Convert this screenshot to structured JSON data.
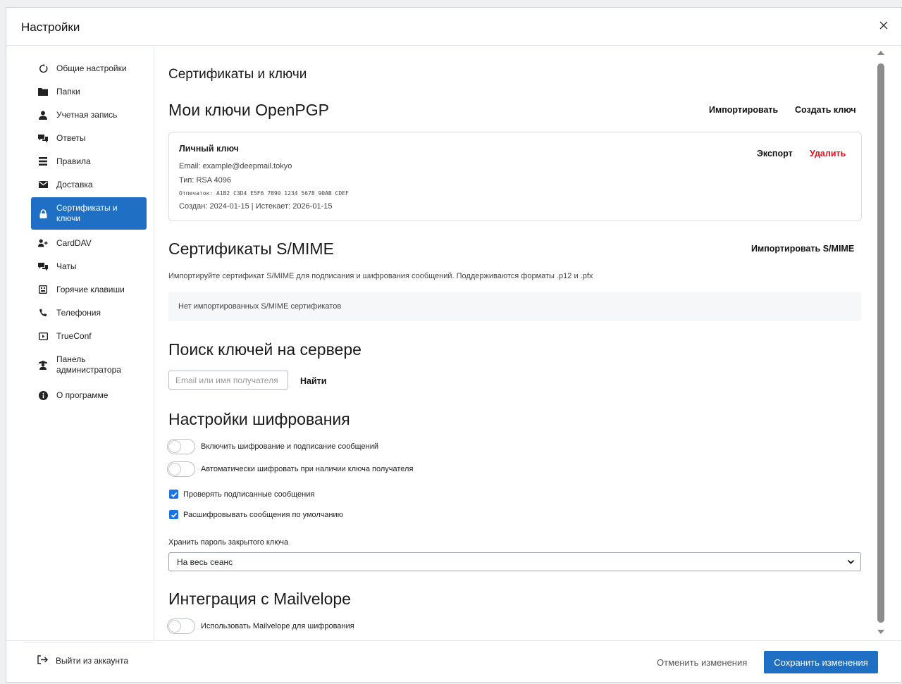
{
  "dialog": {
    "title": "Настройки"
  },
  "sidebar": {
    "items": [
      {
        "label": "Общие настройки",
        "icon": "refresh-icon"
      },
      {
        "label": "Папки",
        "icon": "folder-icon"
      },
      {
        "label": "Учетная запись",
        "icon": "user-icon"
      },
      {
        "label": "Ответы",
        "icon": "chat-icon"
      },
      {
        "label": "Правила",
        "icon": "list-icon"
      },
      {
        "label": "Доставка",
        "icon": "envelope-icon"
      },
      {
        "label": "Сертификаты и ключи",
        "icon": "lock-icon",
        "active": true
      },
      {
        "label": "CardDAV",
        "icon": "user-plus-icon"
      },
      {
        "label": "Чаты",
        "icon": "chat-icon"
      },
      {
        "label": "Горячие клавиши",
        "icon": "keyboard-icon"
      },
      {
        "label": "Телефония",
        "icon": "phone-icon"
      },
      {
        "label": "TrueConf",
        "icon": "video-icon"
      },
      {
        "label": "Панель администратора",
        "icon": "shield-user-icon"
      },
      {
        "label": "О программе",
        "icon": "info-icon"
      }
    ],
    "logout": "Выйти из аккаунта"
  },
  "content": {
    "page_title": "Сертификаты и ключи",
    "openpgp": {
      "title": "Мои ключи OpenPGP",
      "import": "Импортировать",
      "create": "Создать ключ",
      "key": {
        "name": "Личный ключ",
        "email": "Email: example@deepmail.tokyo",
        "type": "Тип: RSA 4096",
        "fingerprint": "Отпечаток: A1B2 C3D4 E5F6 7890 1234 5678 90AB CDEF",
        "dates": "Создан: 2024-01-15 | Истекает: 2026-01-15",
        "export": "Экспорт",
        "delete": "Удалить"
      }
    },
    "smime": {
      "title": "Сертификаты S/MIME",
      "import": "Импортировать S/MIME",
      "description": "Импортируйте сертификат S/MIME для подписания и шифрования сообщений. Поддерживаются форматы .p12 и .pfx",
      "empty": "Нет импортированных S/MIME сертификатов"
    },
    "search": {
      "title": "Поиск ключей на сервере",
      "placeholder": "Email или имя получателя",
      "button": "Найти"
    },
    "encryption": {
      "title": "Настройки шифрования",
      "toggle_enable": "Включить шифрование и подписание сообщений",
      "toggle_auto": "Автоматически шифровать при наличии ключа получателя",
      "check_verify": "Проверять подписанные сообщения",
      "check_decrypt": "Расшифровывать сообщения по умолчанию",
      "store_label": "Хранить пароль закрытого ключа",
      "store_value": "На весь сеанс"
    },
    "mailvelope": {
      "title": "Интеграция с Mailvelope",
      "toggle": "Использовать Mailvelope для шифрования"
    }
  },
  "footer": {
    "cancel": "Отменить изменения",
    "save": "Сохранить изменения"
  },
  "colors": {
    "accent": "#1f6fc5",
    "danger": "#e0101a"
  }
}
